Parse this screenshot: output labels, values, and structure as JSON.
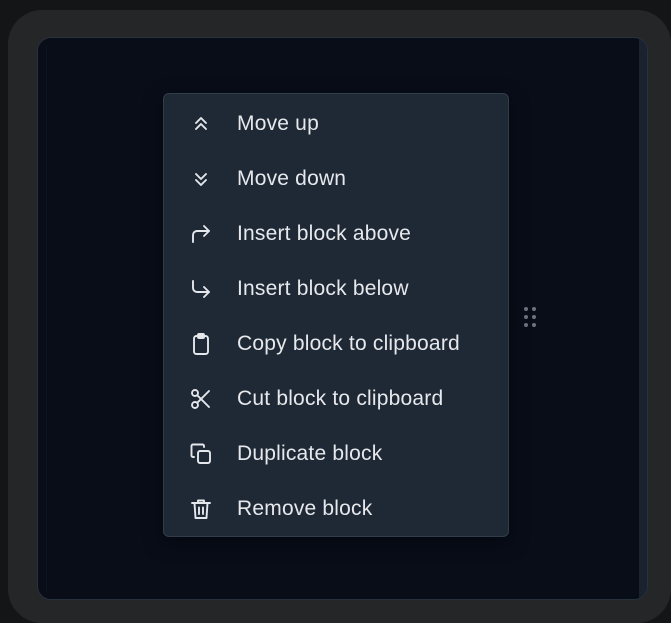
{
  "menu": {
    "items": [
      {
        "label": "Move up",
        "icon": "chevrons-up-icon"
      },
      {
        "label": "Move down",
        "icon": "chevrons-down-icon"
      },
      {
        "label": "Insert block above",
        "icon": "corner-up-right-icon"
      },
      {
        "label": "Insert block below",
        "icon": "corner-down-right-icon"
      },
      {
        "label": "Copy block to clipboard",
        "icon": "clipboard-icon"
      },
      {
        "label": "Cut block to clipboard",
        "icon": "scissors-icon"
      },
      {
        "label": "Duplicate block",
        "icon": "copy-icon"
      },
      {
        "label": "Remove block",
        "icon": "trash-icon"
      }
    ]
  },
  "drag_handle": {
    "icon": "grip-vertical-icon"
  },
  "colors": {
    "background": "#141517",
    "frame": "#242628",
    "editor": "#080d18",
    "menu_background": "#1f2935",
    "menu_border": "#323d4b",
    "text": "#e6e8ec"
  }
}
